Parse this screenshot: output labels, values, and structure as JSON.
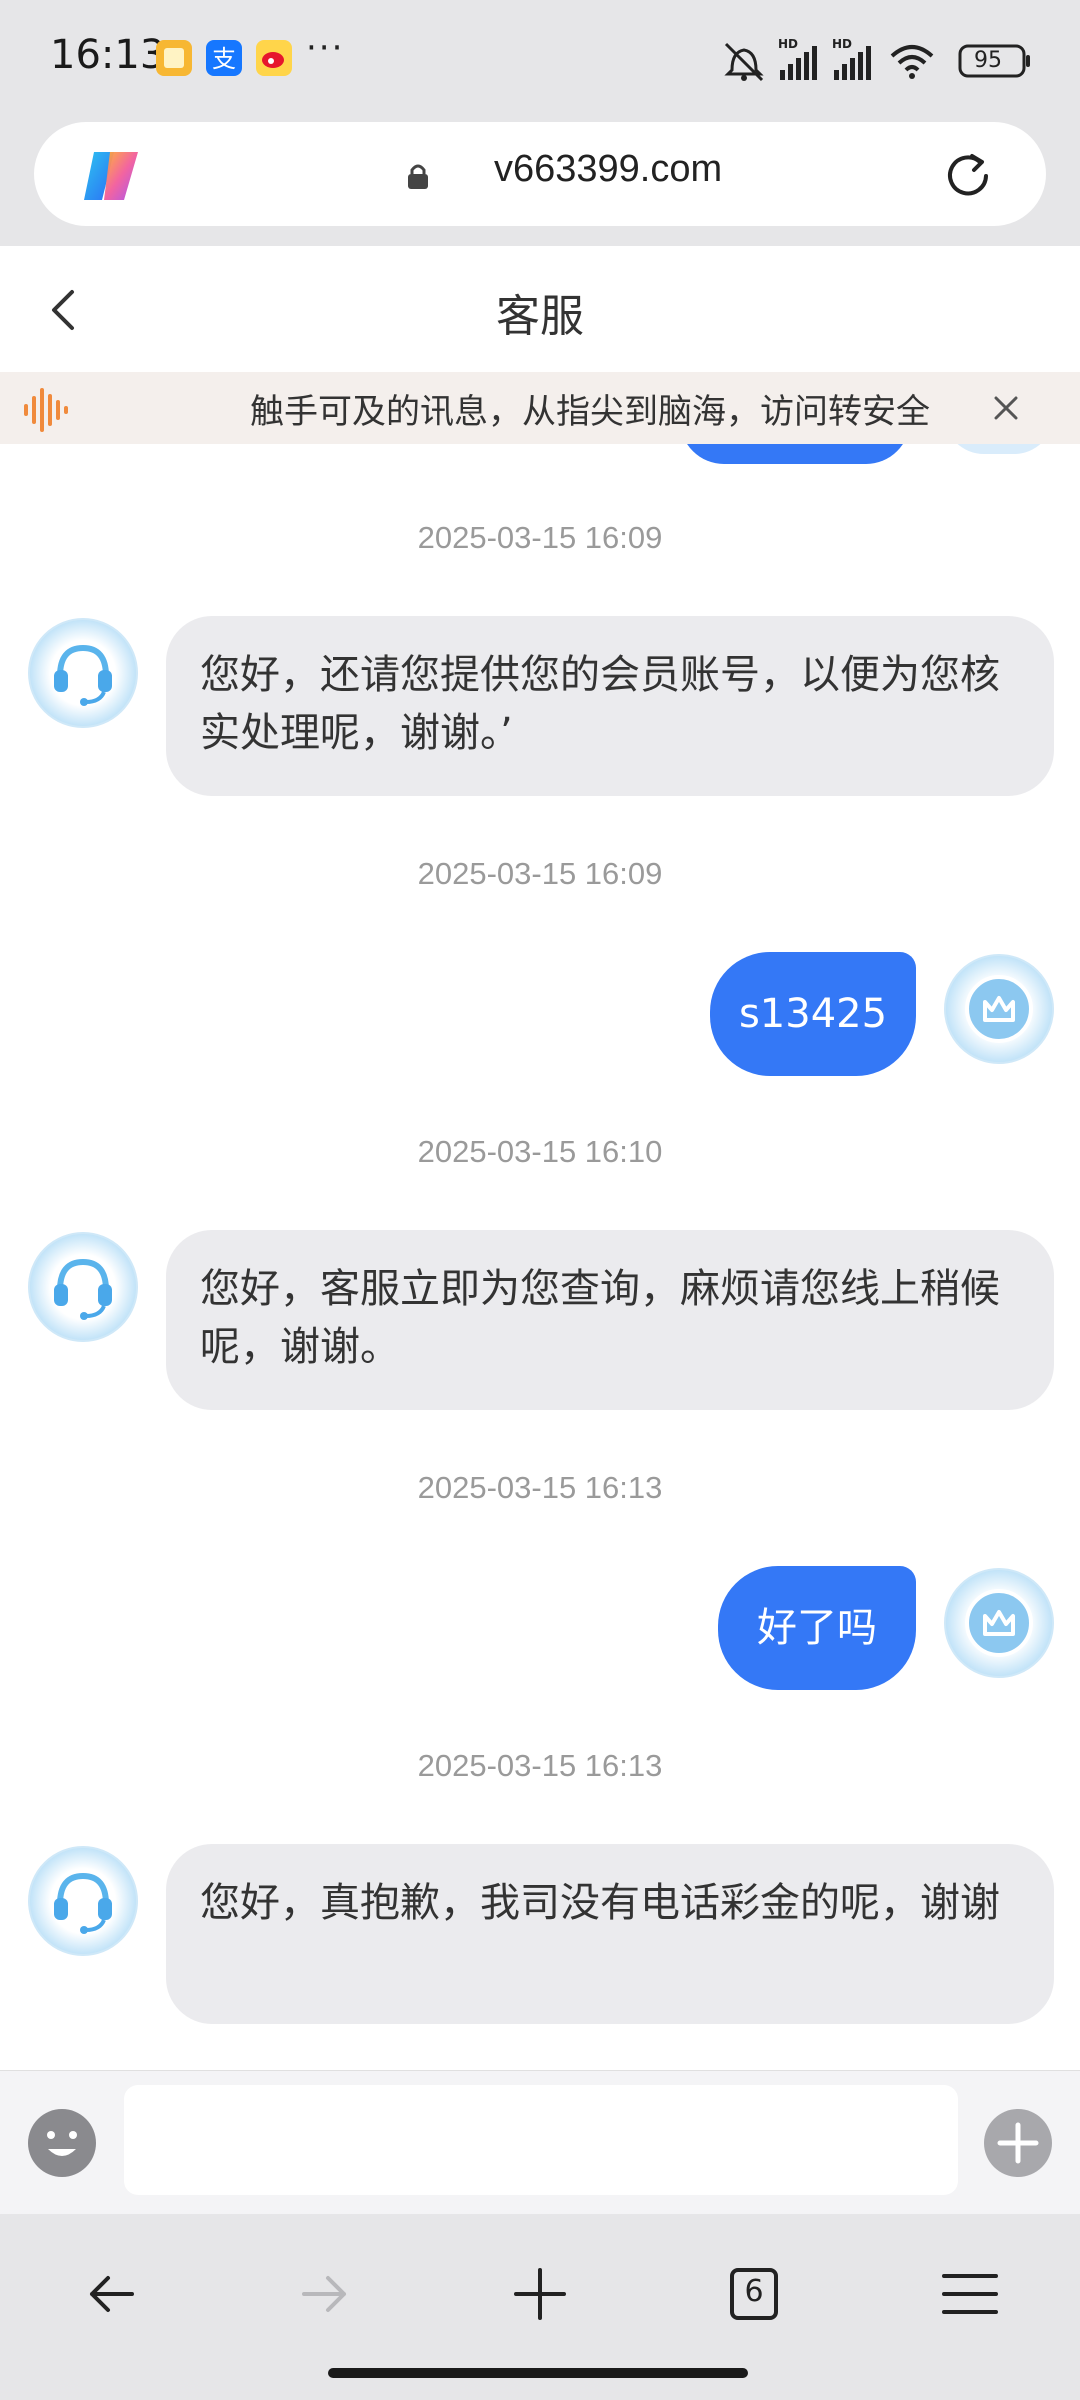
{
  "status_bar": {
    "time": "16:13",
    "more": "···",
    "battery": "95",
    "apps": [
      "notes-app-icon",
      "alipay-icon",
      "weibo-icon"
    ]
  },
  "browser": {
    "url": "v663399.com"
  },
  "header": {
    "title": "客服"
  },
  "notice": {
    "text": "触手可及的讯息，从指尖到脑海，访问转安全"
  },
  "messages": [
    {
      "timestamp": "2025-03-15 16:09",
      "side": "left",
      "text": "您好，还请您提供您的会员账号，以便为您核实处理呢，谢谢。’"
    },
    {
      "timestamp": "2025-03-15 16:09",
      "side": "right",
      "text": "s13425"
    },
    {
      "timestamp": "2025-03-15 16:10",
      "side": "left",
      "text": "您好，客服立即为您查询，麻烦请您线上稍候呢，谢谢。"
    },
    {
      "timestamp": "2025-03-15 16:13",
      "side": "right",
      "text": "好了吗"
    },
    {
      "timestamp": "2025-03-15 16:13",
      "side": "left",
      "text": "您好，真抱歉，我司没有电话彩金的呢，谢谢"
    }
  ],
  "nav": {
    "tab_count": "6"
  },
  "colors": {
    "accent": "#3478f6",
    "bubble_left": "#ebebee",
    "chrome": "#e6e6e8"
  }
}
